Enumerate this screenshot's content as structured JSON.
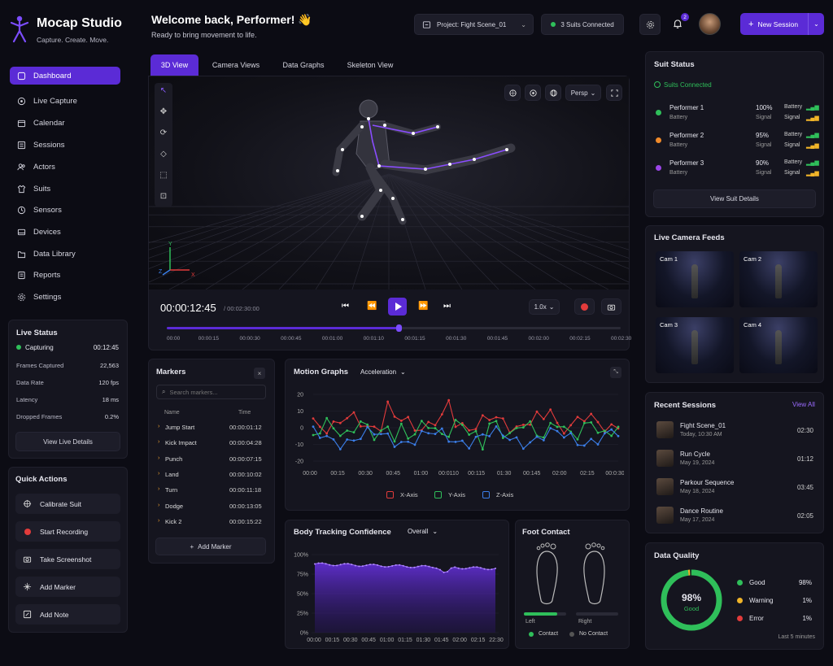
{
  "app": {
    "title": "Mocap Studio",
    "tagline": "Capture. Create. Move."
  },
  "header": {
    "welcome": "Welcome back, Performer! 👋",
    "subtitle": "Ready to bring movement to life.",
    "project": "Project: Fight Scene_01",
    "suits": "3 Suits Connected",
    "notif_count": "2",
    "new_session": "New Session"
  },
  "sidebar": {
    "items": [
      {
        "label": "Dashboard",
        "icon": "grid-icon"
      },
      {
        "label": "Live Capture",
        "icon": "target-icon"
      },
      {
        "label": "Calendar",
        "icon": "calendar-icon"
      },
      {
        "label": "Sessions",
        "icon": "list-icon"
      },
      {
        "label": "Actors",
        "icon": "users-icon"
      },
      {
        "label": "Suits",
        "icon": "shirt-icon"
      },
      {
        "label": "Sensors",
        "icon": "sensor-icon"
      },
      {
        "label": "Devices",
        "icon": "device-icon"
      },
      {
        "label": "Data Library",
        "icon": "folder-icon"
      },
      {
        "label": "Reports",
        "icon": "report-icon"
      },
      {
        "label": "Settings",
        "icon": "gear-icon"
      }
    ]
  },
  "live_status": {
    "title": "Live Status",
    "state": "Capturing",
    "time": "00:12:45",
    "rows": [
      {
        "k": "Frames Captured",
        "v": "22,563"
      },
      {
        "k": "Data Rate",
        "v": "120 fps"
      },
      {
        "k": "Latency",
        "v": "18 ms"
      },
      {
        "k": "Dropped Frames",
        "v": "0.2%"
      }
    ],
    "button": "View Live Details"
  },
  "quick_actions": {
    "title": "Quick Actions",
    "items": [
      "Calibrate Suit",
      "Start Recording",
      "Take Screenshot",
      "Add Marker",
      "Add Note"
    ]
  },
  "tabs": [
    "3D View",
    "Camera Views",
    "Data Graphs",
    "Skeleton View"
  ],
  "viewport": {
    "mode": "Persp",
    "axis_x": "X",
    "axis_y": "Y",
    "axis_z": "Z"
  },
  "playback": {
    "time": "00:00:12:45",
    "total": "/ 00:02:30:00",
    "speed": "1.0x",
    "progress": 0.51,
    "ticks": [
      "00:00",
      "00:00:15",
      "00:00:30",
      "00:00:45",
      "00:01:00",
      "00:01:10",
      "00:01:15",
      "00:01:30",
      "00:01:45",
      "00:02:00",
      "00:02:15",
      "00:02:30"
    ]
  },
  "markers": {
    "title": "Markers",
    "search_placeholder": "Search markers...",
    "col_name": "Name",
    "col_time": "Time",
    "rows": [
      {
        "name": "Jump Start",
        "time": "00:00:01:12"
      },
      {
        "name": "Kick Impact",
        "time": "00:00:04:28"
      },
      {
        "name": "Punch",
        "time": "00:00:07:15"
      },
      {
        "name": "Land",
        "time": "00:00:10:02"
      },
      {
        "name": "Turn",
        "time": "00:00:11:18"
      },
      {
        "name": "Dodge",
        "time": "00:00:13:05"
      },
      {
        "name": "Kick 2",
        "time": "00:00:15:22"
      }
    ],
    "add": "Add Marker"
  },
  "motion_graphs": {
    "title": "Motion Graphs",
    "metric": "Acceleration",
    "yticks": [
      "20",
      "10",
      "0",
      "-10",
      "-20"
    ],
    "xticks": [
      "00:00",
      "00:15",
      "00:30",
      "00:45",
      "01:00",
      "00:0110",
      "00:115",
      "01:30",
      "00:145",
      "02:00",
      "02:15",
      "00:0:30"
    ],
    "legend": [
      "X-Axis",
      "Y-Axis",
      "Z-Axis"
    ],
    "colors": [
      "#e23b3b",
      "#2fbf5a",
      "#3b7ee8"
    ]
  },
  "body_tracking": {
    "title": "Body Tracking Confidence",
    "filter": "Overall",
    "yticks": [
      "100%",
      "75%",
      "50%",
      "25%",
      "0%"
    ],
    "xticks": [
      "00:00",
      "00:15",
      "00:30",
      "00:45",
      "01:00",
      "01:15",
      "01:30",
      "01:45",
      "02:00",
      "02:15",
      "22:30"
    ]
  },
  "foot_contact": {
    "title": "Foot Contact",
    "left": "Left",
    "right": "Right",
    "left_level": 0.78,
    "right_level": 0.0,
    "legend_contact": "Contact",
    "legend_no_contact": "No Contact"
  },
  "suit_status": {
    "title": "Suit Status",
    "connected": "Suits Connected",
    "performers": [
      {
        "name": "Performer 1",
        "pct": "100%",
        "color": "#2fbf5a"
      },
      {
        "name": "Performer 2",
        "pct": "95%",
        "color": "#f08a2a"
      },
      {
        "name": "Performer 3",
        "pct": "90%",
        "color": "#9b45e8"
      }
    ],
    "battery": "Battery",
    "signal": "Signal",
    "button": "View Suit Details"
  },
  "cameras": {
    "title": "Live Camera Feeds",
    "feeds": [
      "Cam 1",
      "Cam 2",
      "Cam 3",
      "Cam 4"
    ]
  },
  "recent_sessions": {
    "title": "Recent Sessions",
    "view_all": "View All",
    "items": [
      {
        "name": "Fight Scene_01",
        "date": "Today, 10:30 AM",
        "dur": "02:30"
      },
      {
        "name": "Run Cycle",
        "date": "May 19, 2024",
        "dur": "01:12"
      },
      {
        "name": "Parkour Sequence",
        "date": "May 18, 2024",
        "dur": "03:45"
      },
      {
        "name": "Dance Routine",
        "date": "May 17, 2024",
        "dur": "02:05"
      }
    ]
  },
  "data_quality": {
    "title": "Data Quality",
    "value": "98%",
    "label": "Good",
    "footer": "Last 5 minutes",
    "items": [
      {
        "k": "Good",
        "v": "98%",
        "color": "#2fbf5a"
      },
      {
        "k": "Warning",
        "v": "1%",
        "color": "#f0b429"
      },
      {
        "k": "Error",
        "v": "1%",
        "color": "#e23b3b"
      }
    ]
  }
}
